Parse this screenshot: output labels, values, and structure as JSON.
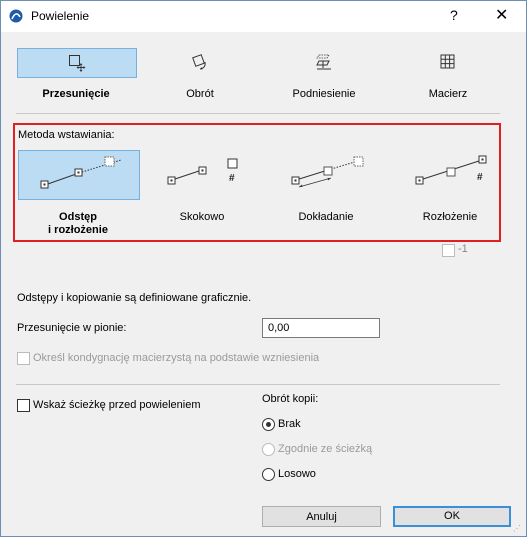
{
  "window": {
    "title": "Powielenie",
    "help_label": "?",
    "close_label": "✕"
  },
  "modes": [
    {
      "label": "Przesunięcie",
      "icon": "move-icon",
      "selected": true
    },
    {
      "label": "Obrót",
      "icon": "rotate-icon",
      "selected": false
    },
    {
      "label": "Podniesienie",
      "icon": "elevate-icon",
      "selected": false
    },
    {
      "label": "Macierz",
      "icon": "matrix-icon",
      "selected": false
    }
  ],
  "method": {
    "title": "Metoda wstawiania:",
    "options": [
      {
        "label_line1": "Odstęp",
        "label_line2": "i rozłożenie",
        "icon": "spacing-distribution-icon",
        "selected": true
      },
      {
        "label_line1": "Skokowo",
        "label_line2": "",
        "icon": "step-icon",
        "selected": false
      },
      {
        "label_line1": "Dokładanie",
        "label_line2": "",
        "icon": "append-icon",
        "selected": false
      },
      {
        "label_line1": "Rozłożenie",
        "label_line2": "",
        "icon": "distribution-icon",
        "selected": false
      }
    ],
    "minus_one_label": "-1",
    "hash_label": "#"
  },
  "info_text": "Odstępy i kopiowanie są definiowane graficznie.",
  "vertical_offset": {
    "label": "Przesunięcie w pionie:",
    "value": "0,00"
  },
  "story_checkbox": {
    "label": "Określ kondygnację macierzystą na podstawie wzniesienia",
    "checked": false,
    "disabled": true
  },
  "show_path": {
    "label": "Wskaż ścieżkę przed powieleniem",
    "checked": false
  },
  "copy_rotation": {
    "title": "Obrót kopii:",
    "options": [
      {
        "label": "Brak",
        "selected": true,
        "disabled": false
      },
      {
        "label": "Zgodnie ze ścieżką",
        "selected": false,
        "disabled": true
      },
      {
        "label": "Losowo",
        "selected": false,
        "disabled": false
      }
    ]
  },
  "buttons": {
    "cancel": "Anuluj",
    "ok": "OK"
  },
  "colors": {
    "selection": "#bcdcf4",
    "highlight_border": "#e02020",
    "ok_border": "#3a8fd8"
  }
}
